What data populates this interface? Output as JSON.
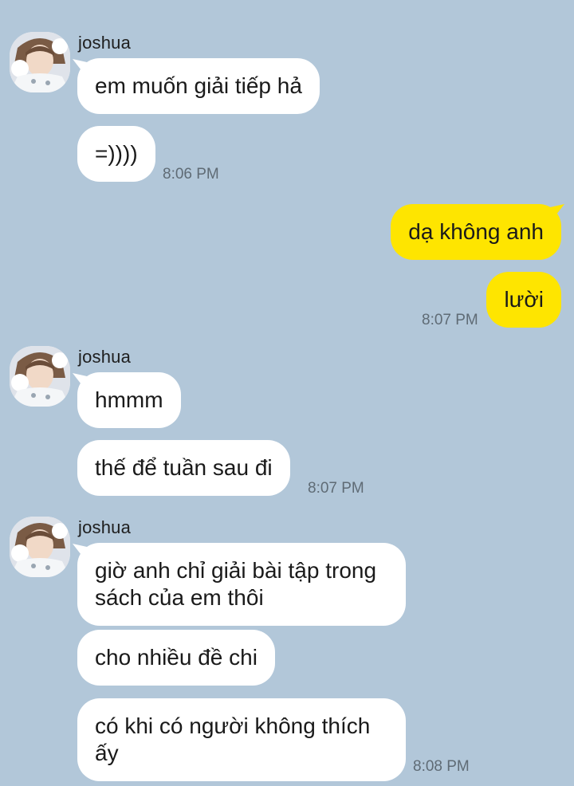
{
  "messages": {
    "g1": {
      "sender": "joshua",
      "b1": "em muốn giải tiếp hả",
      "b2": "=))))",
      "time": "8:06 PM"
    },
    "g2": {
      "b1": "dạ không anh",
      "b2": "lười",
      "time": "8:07 PM"
    },
    "g3": {
      "sender": "joshua",
      "b1": "hmmm",
      "b2": "thế để tuần sau đi",
      "time": "8:07 PM"
    },
    "g4": {
      "sender": "joshua",
      "b1": "giờ anh chỉ giải bài tập trong sách của em thôi",
      "b2": "cho nhiều đề chi",
      "b3": "có khi có người không thích ấy",
      "time": "8:08 PM"
    }
  },
  "colors": {
    "background": "#b2c7d9",
    "incoming_bubble": "#ffffff",
    "outgoing_bubble": "#fee500"
  }
}
